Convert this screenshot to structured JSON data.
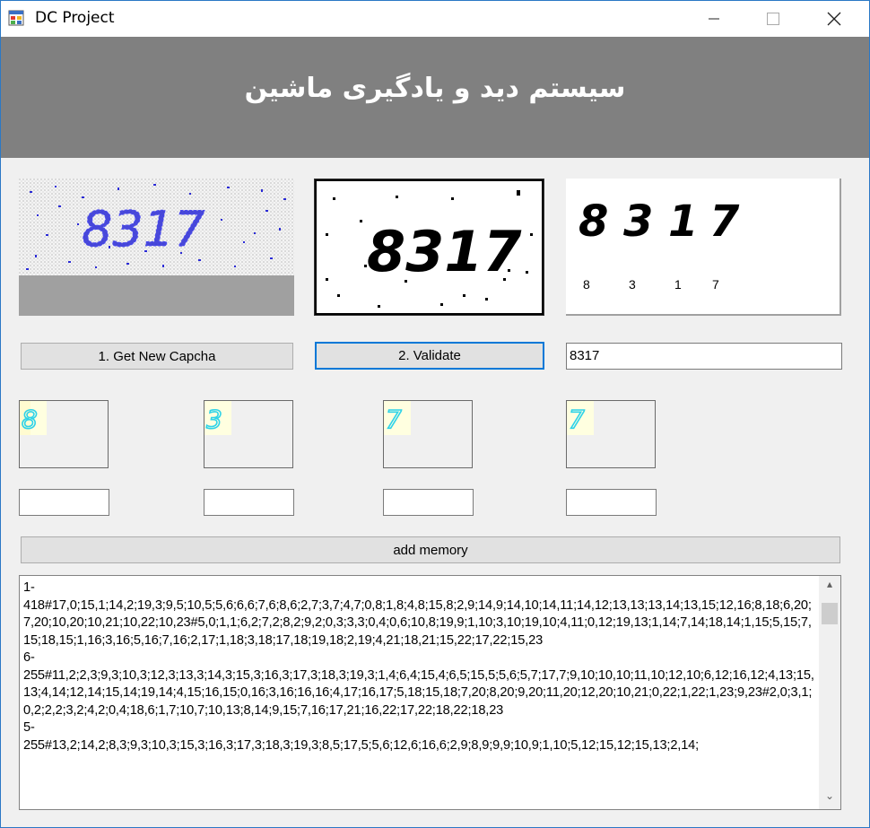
{
  "window": {
    "title": "DC Project"
  },
  "header": {
    "title": "سیستم دید و یادگیری ماشین"
  },
  "captcha": {
    "code": "8317"
  },
  "segmented": {
    "digits": [
      "8",
      "3",
      "1",
      "7"
    ]
  },
  "buttons": {
    "get_new": "1. Get New Capcha",
    "validate": "2. Validate",
    "add_memory": "add memory"
  },
  "result": {
    "value": "8317"
  },
  "digit_inputs": [
    "",
    "",
    "",
    ""
  ],
  "memory": {
    "text": "1-\n418#17,0;15,1;14,2;19,3;9,5;10,5;5,6;6,6;7,6;8,6;2,7;3,7;4,7;0,8;1,8;4,8;15,8;2,9;14,9;14,10;14,11;14,12;13,13;13,14;13,15;12,16;8,18;6,20;7,20;10,20;10,21;10,22;10,23#5,0;1,1;6,2;7,2;8,2;9,2;0,3;3,3;0,4;0,6;10,8;19,9;1,10;3,10;19,10;4,11;0,12;19,13;1,14;7,14;18,14;1,15;5,15;7,15;18,15;1,16;3,16;5,16;7,16;2,17;1,18;3,18;17,18;19,18;2,19;4,21;18,21;15,22;17,22;15,23\n6-\n255#11,2;2,3;9,3;10,3;12,3;13,3;14,3;15,3;16,3;17,3;18,3;19,3;1,4;6,4;15,4;6,5;15,5;5,6;5,7;17,7;9,10;10,10;11,10;12,10;6,12;16,12;4,13;15,13;4,14;12,14;15,14;19,14;4,15;16,15;0,16;3,16;16,16;4,17;16,17;5,18;15,18;7,20;8,20;9,20;11,20;12,20;10,21;0,22;1,22;1,23;9,23#2,0;3,1;0,2;2,2;3,2;4,2;0,4;18,6;1,7;10,7;10,13;8,14;9,15;7,16;17,21;16,22;17,22;18,22;18,23\n5-\n255#13,2;14,2;8,3;9,3;10,3;15,3;16,3;17,3;18,3;19,3;8,5;17,5;5,6;12,6;16,6;2,9;8,9;9,9;10,9;1,10;5,12;15,12;15,13;2,14;"
  },
  "colors": {
    "header_bg": "#808080",
    "window_bg": "#f0f0f0",
    "captcha_digit": "#2a2ad6",
    "accent": "#0078d7"
  }
}
